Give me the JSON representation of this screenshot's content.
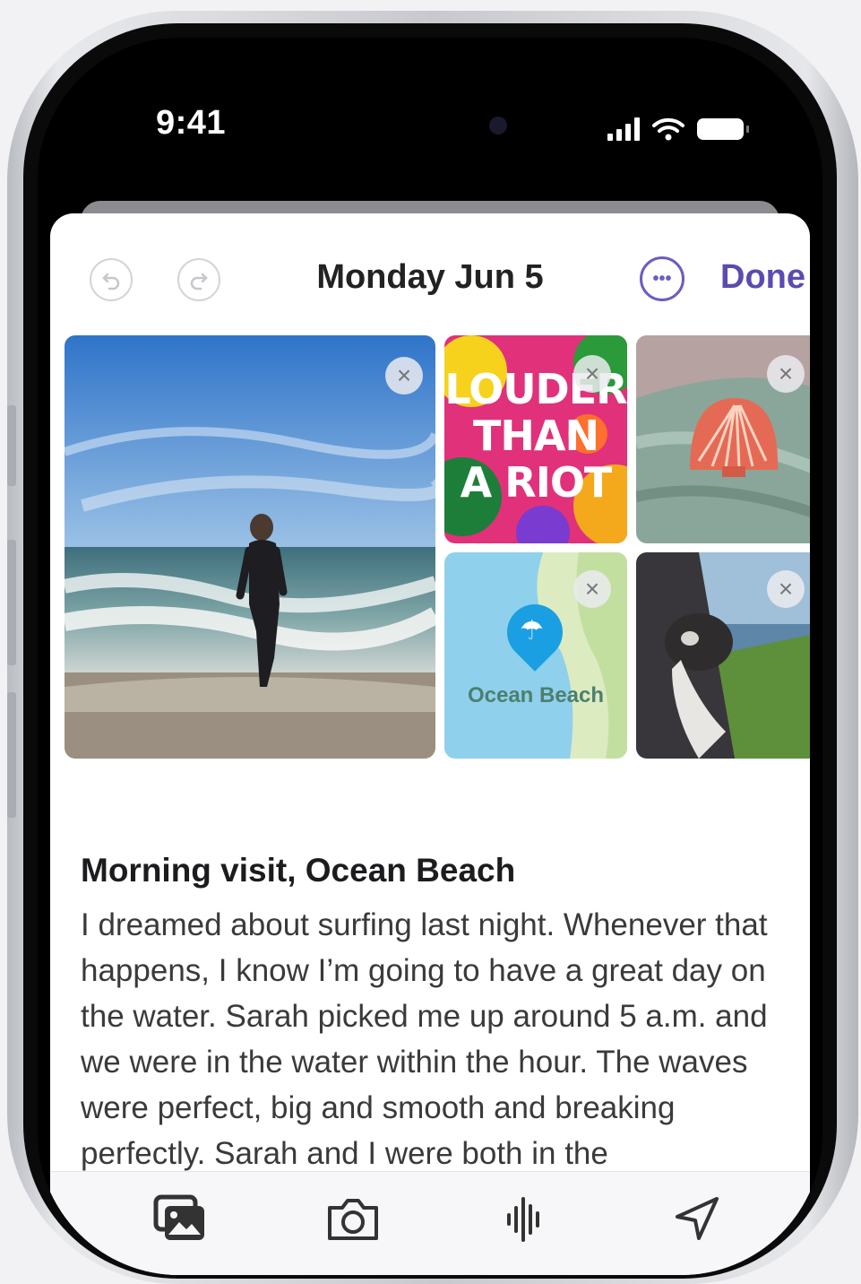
{
  "status_bar": {
    "time": "9:41",
    "icons": [
      "signal-icon",
      "wifi-icon",
      "battery-icon"
    ]
  },
  "nav": {
    "undo_icon": "undo-icon",
    "redo_icon": "redo-icon",
    "title": "Monday Jun 5",
    "more_icon": "ellipsis-circle-icon",
    "done_label": "Done",
    "accent_color": "#5b4bb0"
  },
  "attachments": [
    {
      "type": "photo",
      "subject": "person wading at the beach",
      "remove_icon": "close-icon"
    },
    {
      "type": "music",
      "cover_text": [
        "LOUDER",
        "THAN",
        "A RIOT"
      ],
      "remove_icon": "close-icon"
    },
    {
      "type": "photo",
      "subject": "seashell on a sweater",
      "remove_icon": "close-icon"
    },
    {
      "type": "map",
      "pin_icon": "umbrella-icon",
      "place_label": "Ocean Beach",
      "remove_icon": "close-icon"
    },
    {
      "type": "photo",
      "subject": "dog in a car window",
      "remove_icon": "close-icon"
    }
  ],
  "entry": {
    "title": "Morning visit, Ocean Beach",
    "body": "I dreamed about surfing last night. Whenever that happens, I know I’m going to have a great day on the water. Sarah picked me up around 5 a.m. and we were in the water within the hour. The waves were perfect, big and smooth and breaking perfectly. Sarah and I were both in the"
  },
  "toolbar": {
    "items": [
      {
        "icon": "photo-library-icon"
      },
      {
        "icon": "camera-icon"
      },
      {
        "icon": "waveform-icon"
      },
      {
        "icon": "location-arrow-icon"
      }
    ]
  }
}
